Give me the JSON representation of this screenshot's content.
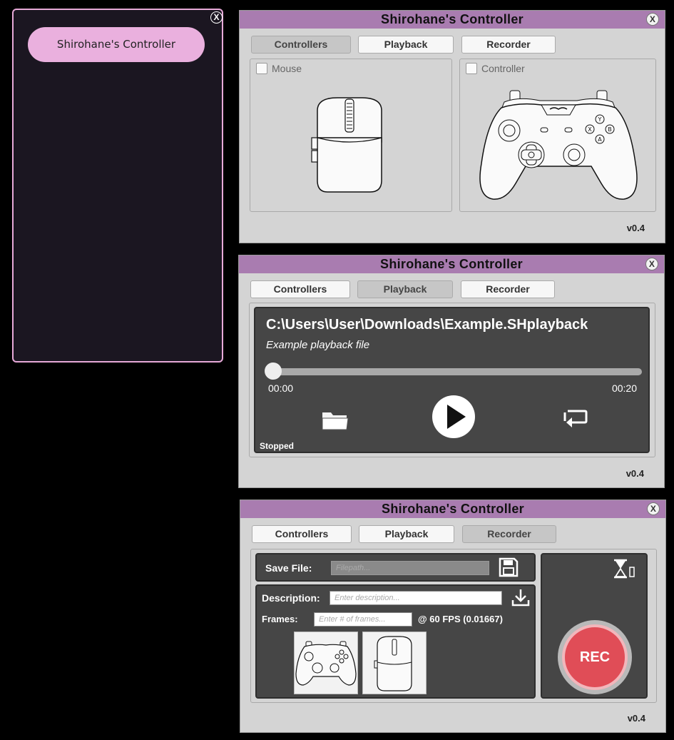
{
  "launcher": {
    "close_label": "X",
    "button_label": "Shirohane's Controller"
  },
  "windows": {
    "controllers": {
      "title": "Shirohane's Controller",
      "close_label": "X",
      "tabs": [
        "Controllers",
        "Playback",
        "Recorder"
      ],
      "active_tab": "Controllers",
      "mouse_label": "Mouse",
      "controller_label": "Controller",
      "version": "v0.4"
    },
    "playback": {
      "title": "Shirohane's Controller",
      "close_label": "X",
      "tabs": [
        "Controllers",
        "Playback",
        "Recorder"
      ],
      "active_tab": "Playback",
      "file_path": "C:\\Users\\User\\Downloads\\Example.SHplayback",
      "description": "Example playback file",
      "time_current": "00:00",
      "time_total": "00:20",
      "progress": 0,
      "status": "Stopped",
      "version": "v0.4"
    },
    "recorder": {
      "title": "Shirohane's Controller",
      "close_label": "X",
      "tabs": [
        "Controllers",
        "Playback",
        "Recorder"
      ],
      "active_tab": "Recorder",
      "save_file_label": "Save File:",
      "save_file_placeholder": "Filepath...",
      "description_label": "Description:",
      "description_placeholder": "Enter description...",
      "frames_label": "Frames:",
      "frames_placeholder": "Enter # of frames...",
      "fps_text": "@ 60 FPS (0.01667)",
      "rec_label": "REC",
      "version": "v0.4"
    }
  },
  "colors": {
    "titlebar": "#a97cb0",
    "launcher_accent": "#eab0de",
    "rec_button": "#e04d57",
    "panel_dark": "#464646"
  }
}
